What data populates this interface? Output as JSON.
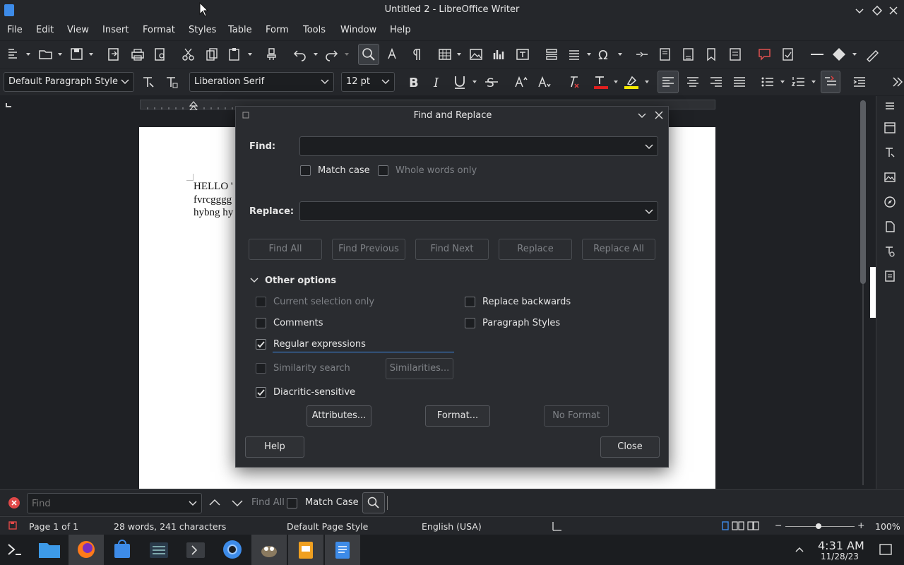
{
  "window": {
    "title": "Untitled 2 - LibreOffice Writer"
  },
  "menu": [
    "File",
    "Edit",
    "View",
    "Insert",
    "Format",
    "Styles",
    "Table",
    "Form",
    "Tools",
    "Window",
    "Help"
  ],
  "formatting": {
    "paragraph_style": "Default Paragraph Style",
    "font_name": "Liberation Serif",
    "font_size": "12 pt"
  },
  "document": {
    "lines": [
      "HELLO '",
      "fvrcgggg",
      "hybng hy"
    ]
  },
  "dialog": {
    "title": "Find and Replace",
    "find_label": "Find:",
    "find_value": "",
    "match_case": "Match case",
    "whole_words": "Whole words only",
    "replace_label": "Replace:",
    "replace_value": "",
    "buttons": {
      "find_all": "Find All",
      "find_previous": "Find Previous",
      "find_next": "Find Next",
      "replace": "Replace",
      "replace_all": "Replace All",
      "attributes": "Attributes...",
      "format": "Format...",
      "no_format": "No Format",
      "similarities": "Similarities...",
      "help": "Help",
      "close": "Close"
    },
    "other_options": "Other options",
    "options": {
      "current_selection_only": "Current selection only",
      "comments": "Comments",
      "regular_expressions": "Regular expressions",
      "similarity_search": "Similarity search",
      "diacritic_sensitive": "Diacritic-sensitive",
      "replace_backwards": "Replace backwards",
      "paragraph_styles": "Paragraph Styles"
    },
    "checked": {
      "regular_expressions": true,
      "diacritic_sensitive": true
    }
  },
  "findbar": {
    "placeholder": "Find",
    "find_all": "Find All",
    "match_case": "Match Case"
  },
  "status": {
    "page": "Page 1 of 1",
    "words": "28 words, 241 characters",
    "page_style": "Default Page Style",
    "language": "English (USA)",
    "zoom": "100%"
  },
  "taskbar": {
    "time": "4:31 AM",
    "date": "11/28/23"
  },
  "colors": {
    "accent": "#3d8be8",
    "font_color_bar": "#e02020",
    "highlight_bar": "#f5e900"
  }
}
